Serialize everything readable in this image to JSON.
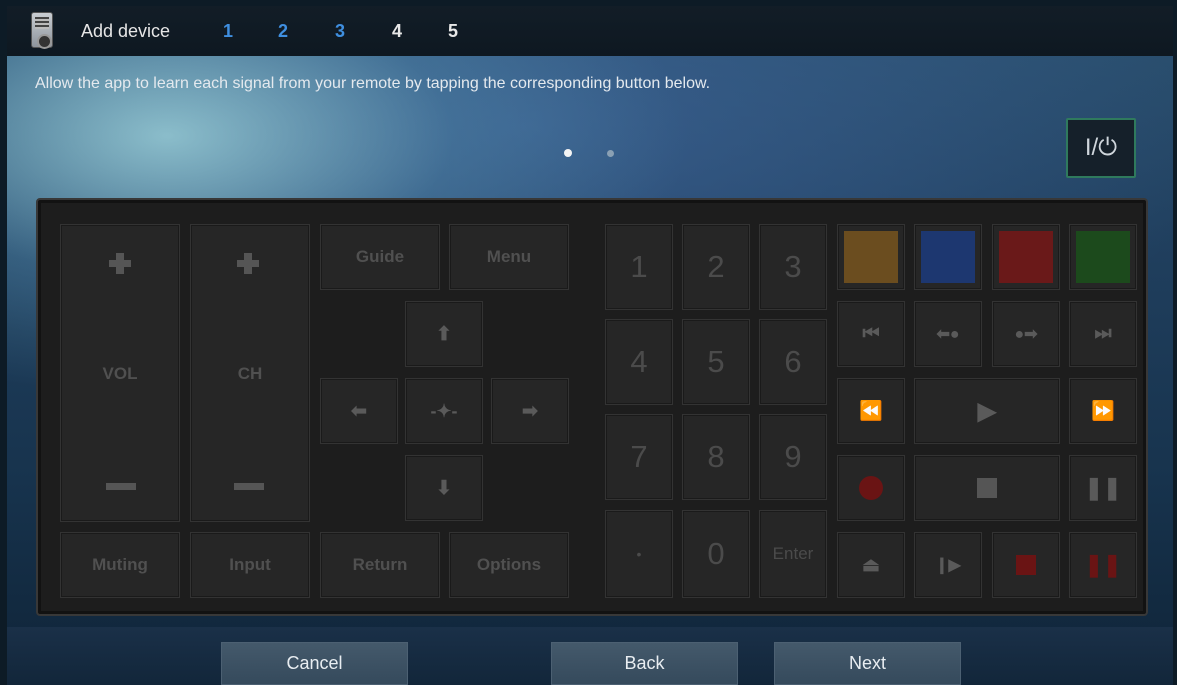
{
  "header": {
    "title": "Add device",
    "steps": [
      {
        "label": "1",
        "state": "done"
      },
      {
        "label": "2",
        "state": "done"
      },
      {
        "label": "3",
        "state": "done"
      },
      {
        "label": "4",
        "state": "todo"
      },
      {
        "label": "5",
        "state": "todo"
      }
    ]
  },
  "instruction": "Allow the app to learn each signal from your remote by tapping the corresponding button below.",
  "pager": {
    "pages": 2,
    "current": 1
  },
  "power_label": "I/⏻",
  "remote": {
    "vol_label": "VOL",
    "ch_label": "CH",
    "guide": "Guide",
    "menu": "Menu",
    "muting": "Muting",
    "input": "Input",
    "return": "Return",
    "options": "Options",
    "digits": [
      "1",
      "2",
      "3",
      "4",
      "5",
      "6",
      "7",
      "8",
      "9",
      "•",
      "0",
      "Enter"
    ],
    "color_keys": [
      "#6b4d1f",
      "#1d3770",
      "#6a1919",
      "#1c4a1c"
    ],
    "record_color": "#6a1414"
  },
  "footer": {
    "cancel": "Cancel",
    "back": "Back",
    "next": "Next"
  },
  "colors": {
    "accent_step": "#3f8fe0",
    "power_border": "#2f7a5d"
  }
}
